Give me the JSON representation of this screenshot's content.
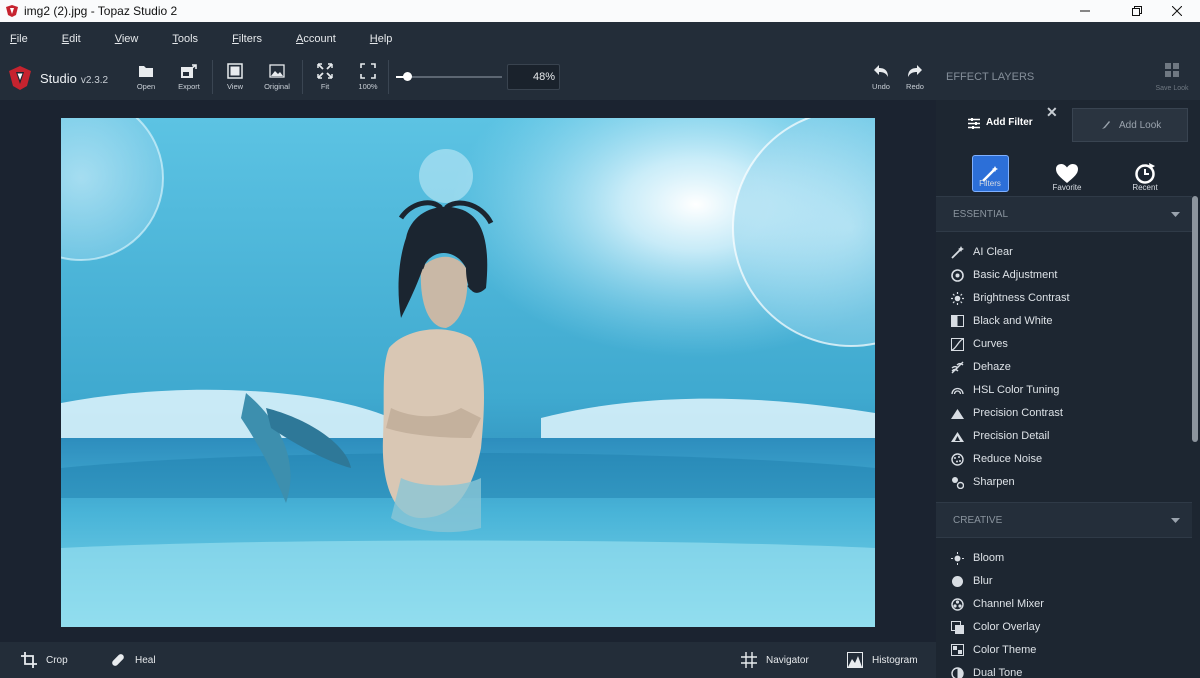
{
  "window": {
    "title": "img2 (2).jpg - Topaz Studio 2"
  },
  "menu": [
    "File",
    "Edit",
    "View",
    "Tools",
    "Filters",
    "Account",
    "Help"
  ],
  "toolbar": {
    "app_name": "Studio",
    "version": "v2.3.2",
    "buttons": [
      "Open",
      "Export",
      "View",
      "Original",
      "Fit",
      "100%"
    ],
    "zoom_level": 0.1,
    "zoom_value": "48%",
    "undo": "Undo",
    "redo": "Redo"
  },
  "right_panel": {
    "title": "EFFECT LAYERS",
    "save_look": "Save Look",
    "add_filter": "Add Filter",
    "add_look": "Add Look",
    "categories": [
      "Filters",
      "Favorite",
      "Recent"
    ],
    "essential": {
      "header": "ESSENTIAL",
      "items": [
        "AI Clear",
        "Basic Adjustment",
        "Brightness Contrast",
        "Black and White",
        "Curves",
        "Dehaze",
        "HSL Color Tuning",
        "Precision Contrast",
        "Precision Detail",
        "Reduce Noise",
        "Sharpen"
      ]
    },
    "creative": {
      "header": "CREATIVE",
      "items": [
        "Bloom",
        "Blur",
        "Channel Mixer",
        "Color Overlay",
        "Color Theme",
        "Dual Tone"
      ]
    }
  },
  "bottom": {
    "crop": "Crop",
    "heal": "Heal",
    "navigator": "Navigator",
    "histogram": "Histogram"
  },
  "colors": {
    "accent": "#2c6fd8",
    "panel": "#232d39",
    "background": "#1d2631"
  }
}
